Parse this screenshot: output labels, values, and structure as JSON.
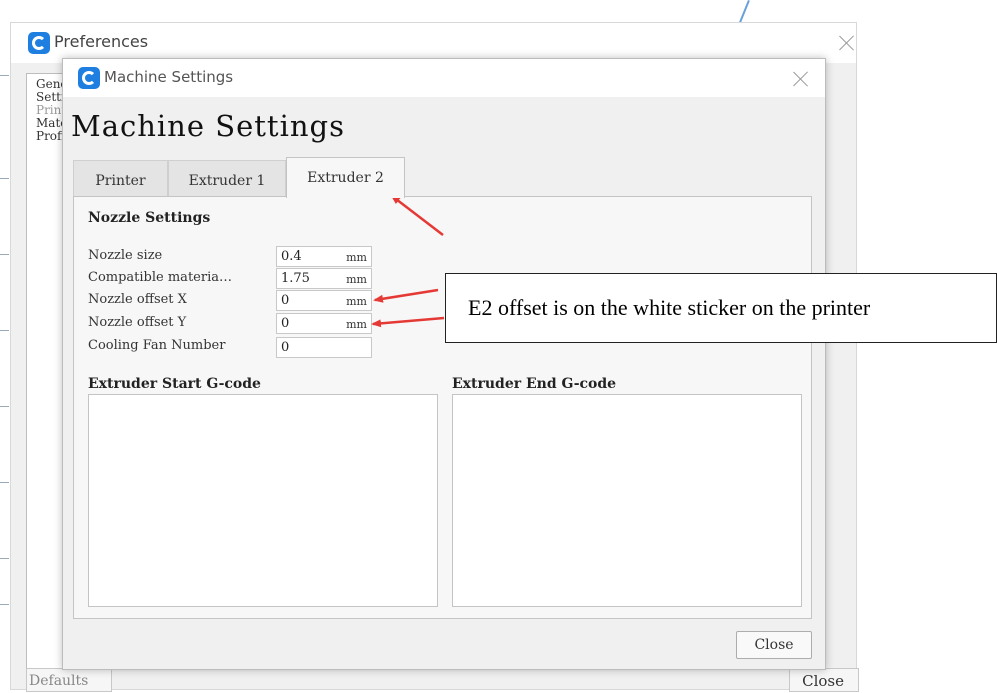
{
  "preferences": {
    "title": "Preferences",
    "sidebar_items": [
      "General",
      "Settings",
      "Printers",
      "Materials",
      "Profiles"
    ],
    "defaults_label": "Defaults",
    "close_label": "Close"
  },
  "machine_settings": {
    "window_title": "Machine Settings",
    "heading": "Machine Settings",
    "tabs": [
      {
        "label": "Printer",
        "active": false
      },
      {
        "label": "Extruder 1",
        "active": false
      },
      {
        "label": "Extruder 2",
        "active": true
      }
    ],
    "nozzle_settings": {
      "title": "Nozzle Settings",
      "fields": [
        {
          "label": "Nozzle size",
          "value": "0.4",
          "unit": "mm"
        },
        {
          "label": "Compatible materia…",
          "value": "1.75",
          "unit": "mm"
        },
        {
          "label": "Nozzle offset X",
          "value": "0",
          "unit": "mm"
        },
        {
          "label": "Nozzle offset Y",
          "value": "0",
          "unit": "mm"
        },
        {
          "label": "Cooling Fan Number",
          "value": "0",
          "unit": ""
        }
      ]
    },
    "start_gcode_label": "Extruder Start G-code",
    "start_gcode_value": "",
    "end_gcode_label": "Extruder End G-code",
    "end_gcode_value": "",
    "close_label": "Close"
  },
  "annotation": {
    "text": "E2 offset is on the white sticker on the printer",
    "arrow_color": "#e53935"
  },
  "colors": {
    "logo_blue": "#1e7fe0",
    "dialog_bg": "#f0f0f0"
  }
}
